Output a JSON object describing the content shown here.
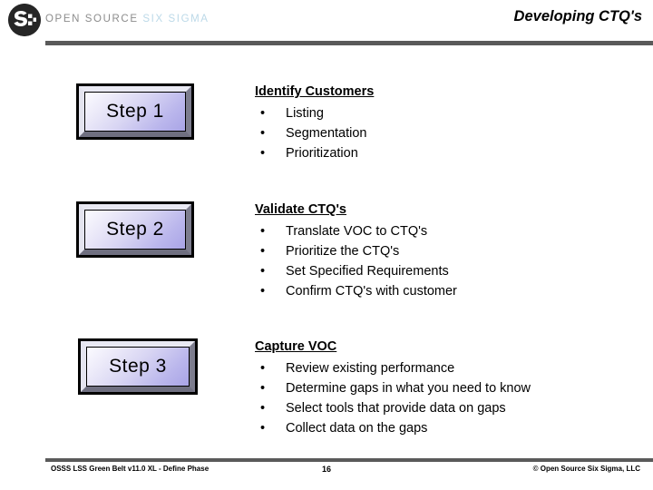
{
  "header": {
    "logo_icon": "osss-circle-logo-icon",
    "brand_primary": "OPEN SOURCE",
    "brand_secondary": "SIX SIGMA",
    "title": "Developing CTQ's",
    "brand_primary_color": "#8c8c8c",
    "brand_secondary_color": "#bcd9e8",
    "rule_color": "#5a5a5a"
  },
  "steps": [
    {
      "box_label": "Step 1",
      "heading": "Identify Customers",
      "bullets": [
        "Listing",
        "Segmentation",
        "Prioritization"
      ]
    },
    {
      "box_label": "Step 2",
      "heading": "Validate CTQ's",
      "bullets": [
        "Translate VOC to CTQ's",
        "Prioritize the CTQ's",
        "Set Specified Requirements",
        "Confirm CTQ's with customer"
      ]
    },
    {
      "box_label": "Step 3",
      "heading": "Capture VOC",
      "bullets": [
        "Review existing performance",
        "Determine gaps in what you need to know",
        "Select tools that provide data on gaps",
        "Collect data on the gaps"
      ]
    }
  ],
  "bullet_glyph": "•",
  "footer": {
    "left": "OSSS LSS Green Belt v11.0 XL - Define Phase",
    "page_number": "16",
    "copyright": "© Open Source Six Sigma, LLC"
  }
}
